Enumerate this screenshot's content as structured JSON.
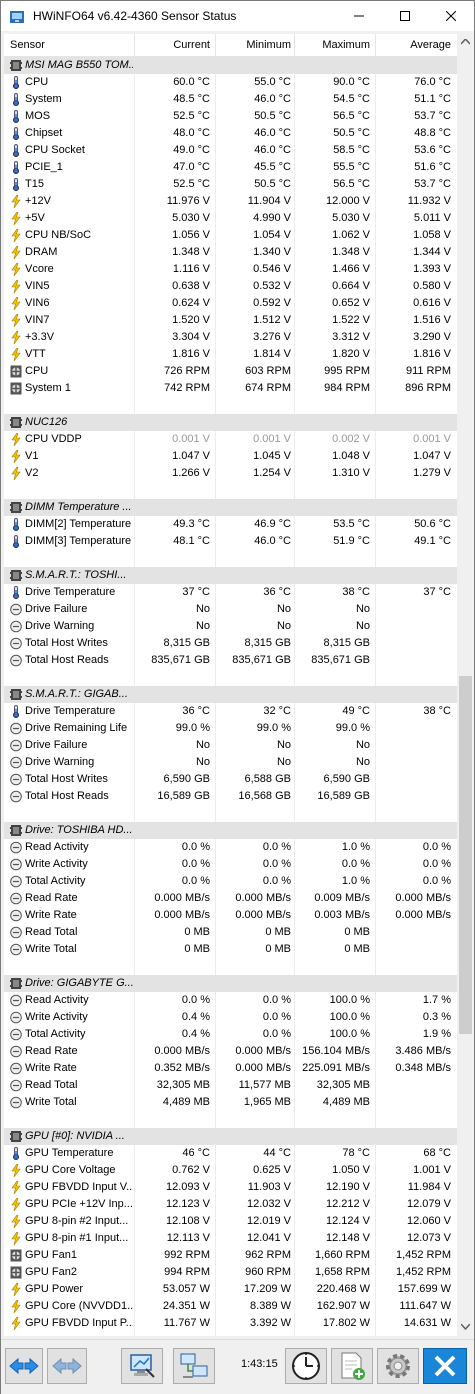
{
  "window": {
    "title": "HWiNFO64 v6.42-4360 Sensor Status"
  },
  "header": {
    "sensor": "Sensor",
    "current": "Current",
    "minimum": "Minimum",
    "maximum": "Maximum",
    "average": "Average"
  },
  "rows": [
    {
      "type": "group",
      "name": "MSI MAG B550 TOM..."
    },
    {
      "type": "temp",
      "name": "CPU",
      "cur": "60.0 °C",
      "min": "55.0 °C",
      "max": "90.0 °C",
      "avg": "76.0 °C"
    },
    {
      "type": "temp",
      "name": "System",
      "cur": "48.5 °C",
      "min": "46.0 °C",
      "max": "54.5 °C",
      "avg": "51.1 °C"
    },
    {
      "type": "temp",
      "name": "MOS",
      "cur": "52.5 °C",
      "min": "50.5 °C",
      "max": "56.5 °C",
      "avg": "53.7 °C"
    },
    {
      "type": "temp",
      "name": "Chipset",
      "cur": "48.0 °C",
      "min": "46.0 °C",
      "max": "50.5 °C",
      "avg": "48.8 °C"
    },
    {
      "type": "temp",
      "name": "CPU Socket",
      "cur": "49.0 °C",
      "min": "46.0 °C",
      "max": "58.5 °C",
      "avg": "53.6 °C"
    },
    {
      "type": "temp",
      "name": "PCIE_1",
      "cur": "47.0 °C",
      "min": "45.5 °C",
      "max": "55.5 °C",
      "avg": "51.6 °C"
    },
    {
      "type": "temp",
      "name": "T15",
      "cur": "52.5 °C",
      "min": "50.5 °C",
      "max": "56.5 °C",
      "avg": "53.7 °C"
    },
    {
      "type": "volt",
      "name": "+12V",
      "cur": "11.976 V",
      "min": "11.904 V",
      "max": "12.000 V",
      "avg": "11.932 V"
    },
    {
      "type": "volt",
      "name": "+5V",
      "cur": "5.030 V",
      "min": "4.990 V",
      "max": "5.030 V",
      "avg": "5.011 V"
    },
    {
      "type": "volt",
      "name": "CPU NB/SoC",
      "cur": "1.056 V",
      "min": "1.054 V",
      "max": "1.062 V",
      "avg": "1.058 V"
    },
    {
      "type": "volt",
      "name": "DRAM",
      "cur": "1.348 V",
      "min": "1.340 V",
      "max": "1.348 V",
      "avg": "1.344 V"
    },
    {
      "type": "volt",
      "name": "Vcore",
      "cur": "1.116 V",
      "min": "0.546 V",
      "max": "1.466 V",
      "avg": "1.393 V"
    },
    {
      "type": "volt",
      "name": "VIN5",
      "cur": "0.638 V",
      "min": "0.532 V",
      "max": "0.664 V",
      "avg": "0.580 V"
    },
    {
      "type": "volt",
      "name": "VIN6",
      "cur": "0.624 V",
      "min": "0.592 V",
      "max": "0.652 V",
      "avg": "0.616 V"
    },
    {
      "type": "volt",
      "name": "VIN7",
      "cur": "1.520 V",
      "min": "1.512 V",
      "max": "1.522 V",
      "avg": "1.516 V"
    },
    {
      "type": "volt",
      "name": "+3.3V",
      "cur": "3.304 V",
      "min": "3.276 V",
      "max": "3.312 V",
      "avg": "3.290 V"
    },
    {
      "type": "volt",
      "name": "VTT",
      "cur": "1.816 V",
      "min": "1.814 V",
      "max": "1.820 V",
      "avg": "1.816 V"
    },
    {
      "type": "fan",
      "name": "CPU",
      "cur": "726 RPM",
      "min": "603 RPM",
      "max": "995 RPM",
      "avg": "911 RPM"
    },
    {
      "type": "fan",
      "name": "System 1",
      "cur": "742 RPM",
      "min": "674 RPM",
      "max": "984 RPM",
      "avg": "896 RPM"
    },
    {
      "type": "blank"
    },
    {
      "type": "group",
      "name": "NUC126"
    },
    {
      "type": "volt",
      "name": "CPU VDDP",
      "cur": "0.001 V",
      "min": "0.001 V",
      "max": "0.002 V",
      "avg": "0.001 V",
      "gray": true
    },
    {
      "type": "volt",
      "name": "V1",
      "cur": "1.047 V",
      "min": "1.045 V",
      "max": "1.048 V",
      "avg": "1.047 V"
    },
    {
      "type": "volt",
      "name": "V2",
      "cur": "1.266 V",
      "min": "1.254 V",
      "max": "1.310 V",
      "avg": "1.279 V"
    },
    {
      "type": "blank"
    },
    {
      "type": "group",
      "name": "DIMM Temperature ..."
    },
    {
      "type": "temp",
      "name": "DIMM[2] Temperature",
      "cur": "49.3 °C",
      "min": "46.9 °C",
      "max": "53.5 °C",
      "avg": "50.6 °C"
    },
    {
      "type": "temp",
      "name": "DIMM[3] Temperature",
      "cur": "48.1 °C",
      "min": "46.0 °C",
      "max": "51.9 °C",
      "avg": "49.1 °C"
    },
    {
      "type": "blank"
    },
    {
      "type": "group",
      "name": "S.M.A.R.T.: TOSHI..."
    },
    {
      "type": "temp",
      "name": "Drive Temperature",
      "cur": "37 °C",
      "min": "36 °C",
      "max": "38 °C",
      "avg": "37 °C"
    },
    {
      "type": "other",
      "name": "Drive Failure",
      "cur": "No",
      "min": "No",
      "max": "No",
      "avg": ""
    },
    {
      "type": "other",
      "name": "Drive Warning",
      "cur": "No",
      "min": "No",
      "max": "No",
      "avg": ""
    },
    {
      "type": "other",
      "name": "Total Host Writes",
      "cur": "8,315 GB",
      "min": "8,315 GB",
      "max": "8,315 GB",
      "avg": ""
    },
    {
      "type": "other",
      "name": "Total Host Reads",
      "cur": "835,671 GB",
      "min": "835,671 GB",
      "max": "835,671 GB",
      "avg": ""
    },
    {
      "type": "blank"
    },
    {
      "type": "group",
      "name": "S.M.A.R.T.: GIGAB..."
    },
    {
      "type": "temp",
      "name": "Drive Temperature",
      "cur": "36 °C",
      "min": "32 °C",
      "max": "49 °C",
      "avg": "38 °C"
    },
    {
      "type": "other",
      "name": "Drive Remaining Life",
      "cur": "99.0 %",
      "min": "99.0 %",
      "max": "99.0 %",
      "avg": ""
    },
    {
      "type": "other",
      "name": "Drive Failure",
      "cur": "No",
      "min": "No",
      "max": "No",
      "avg": ""
    },
    {
      "type": "other",
      "name": "Drive Warning",
      "cur": "No",
      "min": "No",
      "max": "No",
      "avg": ""
    },
    {
      "type": "other",
      "name": "Total Host Writes",
      "cur": "6,590 GB",
      "min": "6,588 GB",
      "max": "6,590 GB",
      "avg": ""
    },
    {
      "type": "other",
      "name": "Total Host Reads",
      "cur": "16,589 GB",
      "min": "16,568 GB",
      "max": "16,589 GB",
      "avg": ""
    },
    {
      "type": "blank"
    },
    {
      "type": "group",
      "name": "Drive: TOSHIBA HD..."
    },
    {
      "type": "other",
      "name": "Read Activity",
      "cur": "0.0 %",
      "min": "0.0 %",
      "max": "1.0 %",
      "avg": "0.0 %"
    },
    {
      "type": "other",
      "name": "Write Activity",
      "cur": "0.0 %",
      "min": "0.0 %",
      "max": "0.0 %",
      "avg": "0.0 %"
    },
    {
      "type": "other",
      "name": "Total Activity",
      "cur": "0.0 %",
      "min": "0.0 %",
      "max": "1.0 %",
      "avg": "0.0 %"
    },
    {
      "type": "other",
      "name": "Read Rate",
      "cur": "0.000 MB/s",
      "min": "0.000 MB/s",
      "max": "0.009 MB/s",
      "avg": "0.000 MB/s"
    },
    {
      "type": "other",
      "name": "Write Rate",
      "cur": "0.000 MB/s",
      "min": "0.000 MB/s",
      "max": "0.003 MB/s",
      "avg": "0.000 MB/s"
    },
    {
      "type": "other",
      "name": "Read Total",
      "cur": "0 MB",
      "min": "0 MB",
      "max": "0 MB",
      "avg": ""
    },
    {
      "type": "other",
      "name": "Write Total",
      "cur": "0 MB",
      "min": "0 MB",
      "max": "0 MB",
      "avg": ""
    },
    {
      "type": "blank"
    },
    {
      "type": "group",
      "name": "Drive: GIGABYTE G..."
    },
    {
      "type": "other",
      "name": "Read Activity",
      "cur": "0.0 %",
      "min": "0.0 %",
      "max": "100.0 %",
      "avg": "1.7 %"
    },
    {
      "type": "other",
      "name": "Write Activity",
      "cur": "0.4 %",
      "min": "0.0 %",
      "max": "100.0 %",
      "avg": "0.3 %"
    },
    {
      "type": "other",
      "name": "Total Activity",
      "cur": "0.4 %",
      "min": "0.0 %",
      "max": "100.0 %",
      "avg": "1.9 %"
    },
    {
      "type": "other",
      "name": "Read Rate",
      "cur": "0.000 MB/s",
      "min": "0.000 MB/s",
      "max": "156.104 MB/s",
      "avg": "3.486 MB/s"
    },
    {
      "type": "other",
      "name": "Write Rate",
      "cur": "0.352 MB/s",
      "min": "0.000 MB/s",
      "max": "225.091 MB/s",
      "avg": "0.348 MB/s"
    },
    {
      "type": "other",
      "name": "Read Total",
      "cur": "32,305 MB",
      "min": "11,577 MB",
      "max": "32,305 MB",
      "avg": ""
    },
    {
      "type": "other",
      "name": "Write Total",
      "cur": "4,489 MB",
      "min": "1,965 MB",
      "max": "4,489 MB",
      "avg": ""
    },
    {
      "type": "blank"
    },
    {
      "type": "group",
      "name": "GPU [#0]: NVIDIA ..."
    },
    {
      "type": "temp",
      "name": "GPU Temperature",
      "cur": "46 °C",
      "min": "44 °C",
      "max": "78 °C",
      "avg": "68 °C"
    },
    {
      "type": "volt",
      "name": "GPU Core Voltage",
      "cur": "0.762 V",
      "min": "0.625 V",
      "max": "1.050 V",
      "avg": "1.001 V"
    },
    {
      "type": "volt",
      "name": "GPU FBVDD Input V...",
      "cur": "12.093 V",
      "min": "11.903 V",
      "max": "12.190 V",
      "avg": "11.984 V"
    },
    {
      "type": "volt",
      "name": "GPU PCIe +12V Inp...",
      "cur": "12.123 V",
      "min": "12.032 V",
      "max": "12.212 V",
      "avg": "12.079 V"
    },
    {
      "type": "volt",
      "name": "GPU 8-pin #2 Input...",
      "cur": "12.108 V",
      "min": "12.019 V",
      "max": "12.124 V",
      "avg": "12.060 V"
    },
    {
      "type": "volt",
      "name": "GPU 8-pin #1 Input...",
      "cur": "12.113 V",
      "min": "12.041 V",
      "max": "12.148 V",
      "avg": "12.073 V"
    },
    {
      "type": "fan",
      "name": "GPU Fan1",
      "cur": "992 RPM",
      "min": "962 RPM",
      "max": "1,660 RPM",
      "avg": "1,452 RPM"
    },
    {
      "type": "fan",
      "name": "GPU Fan2",
      "cur": "994 RPM",
      "min": "960 RPM",
      "max": "1,658 RPM",
      "avg": "1,452 RPM"
    },
    {
      "type": "volt",
      "name": "GPU Power",
      "cur": "53.057 W",
      "min": "17.209 W",
      "max": "220.468 W",
      "avg": "157.699 W"
    },
    {
      "type": "volt",
      "name": "GPU Core (NVVDD1...",
      "cur": "24.351 W",
      "min": "8.389 W",
      "max": "162.907 W",
      "avg": "111.647 W"
    },
    {
      "type": "volt",
      "name": "GPU FBVDD Input P...",
      "cur": "11.767 W",
      "min": "3.392 W",
      "max": "17.802 W",
      "avg": "14.631 W"
    }
  ],
  "footer": {
    "clock": "1:43:15"
  },
  "colors": {
    "accent": "#1e90ff",
    "close": "#1a86d8",
    "group_bg": "#e3e3e3"
  }
}
